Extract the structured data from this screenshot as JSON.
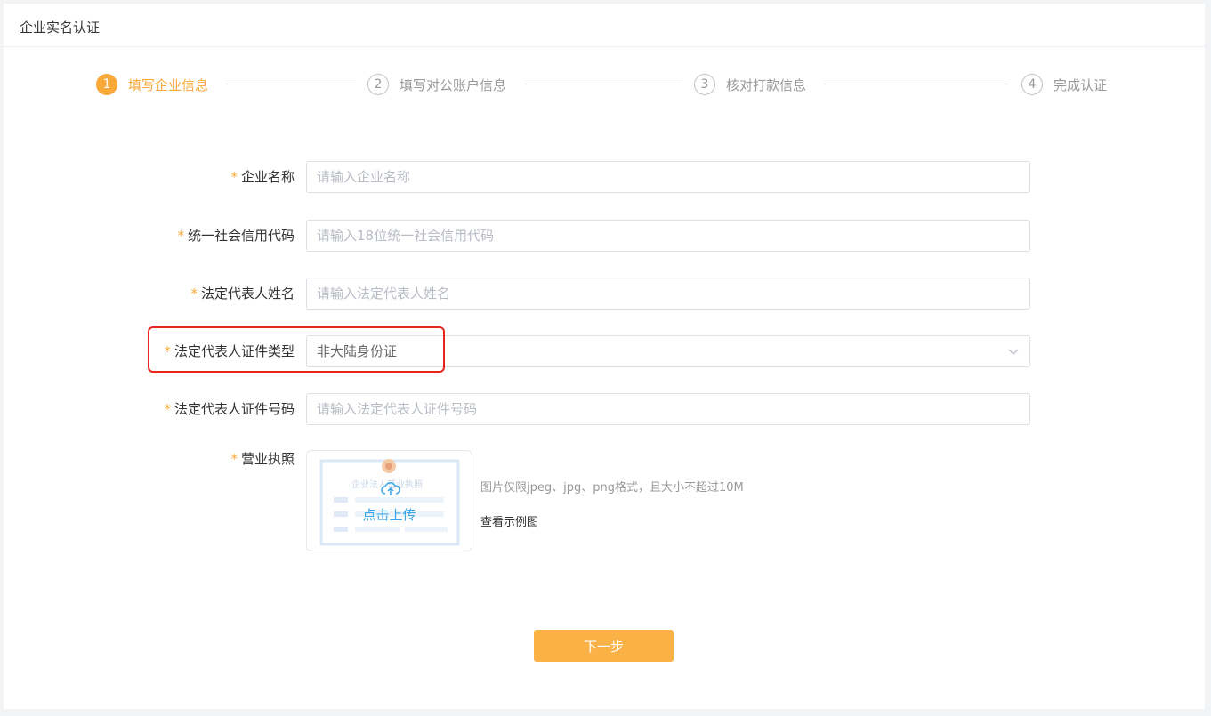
{
  "header": {
    "title": "企业实名认证"
  },
  "steps": [
    {
      "number": "1",
      "label": "填写企业信息"
    },
    {
      "number": "2",
      "label": "填写对公账户信息"
    },
    {
      "number": "3",
      "label": "核对打款信息"
    },
    {
      "number": "4",
      "label": "完成认证"
    }
  ],
  "active_step": 1,
  "form": {
    "required_mark": "*",
    "company_name": {
      "label": "企业名称",
      "placeholder": "请输入企业名称"
    },
    "credit_code": {
      "label": "统一社会信用代码",
      "placeholder": "请输入18位统一社会信用代码"
    },
    "legal_rep_name": {
      "label": "法定代表人姓名",
      "placeholder": "请输入法定代表人姓名"
    },
    "id_type": {
      "label": "法定代表人证件类型",
      "value": "非大陆身份证"
    },
    "id_number": {
      "label": "法定代表人证件号码",
      "placeholder": "请输入法定代表人证件号码"
    },
    "license": {
      "label": "营业执照",
      "upload_label": "点击上传",
      "watermark_text": "企业法人营业执照",
      "hint": "图片仅限jpeg、jpg、png格式，且大小不超过10M",
      "example_link": "查看示例图"
    }
  },
  "next_button": "下一步",
  "colors": {
    "accent": "#f9a83a",
    "highlight": "#e8261c",
    "upload_link": "#3aa5e8"
  }
}
